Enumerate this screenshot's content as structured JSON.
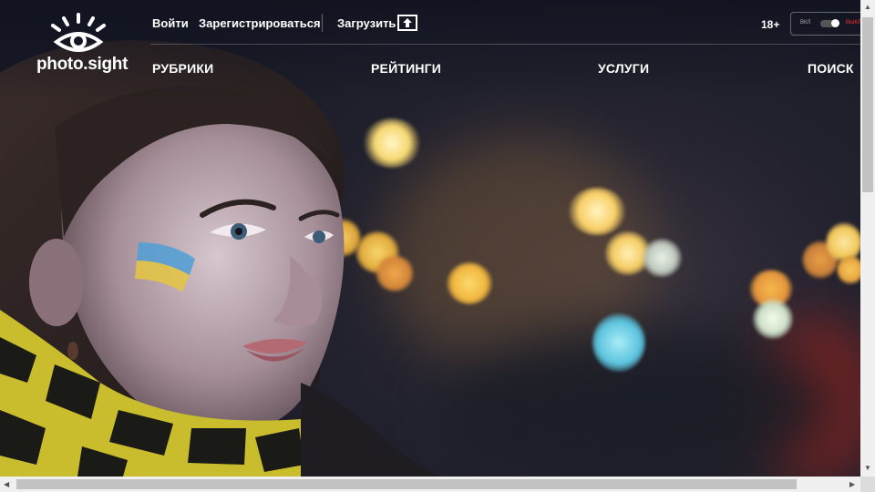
{
  "header": {
    "logo_text": "photo.sight",
    "login_label": "Войти",
    "register_label": "Зарегистрироваться",
    "upload_label": "Загрузить",
    "age_label": "18+",
    "toggle_off_label": "ВКЛ",
    "toggle_on_label": "ВЫКЛ"
  },
  "menu": {
    "rubrics": "РУБРИКИ",
    "ratings": "РЕЙТИНГИ",
    "services": "УСЛУГИ",
    "search": "ПОИСК"
  },
  "colors": {
    "scrollbar_track": "#f0f0f0",
    "scrollbar_thumb": "#c2c2c2",
    "toggle_on_accent": "#e33333"
  },
  "icons": [
    "logo-eye-icon",
    "upload-icon",
    "scroll-up-icon",
    "scroll-down-icon",
    "scroll-left-icon",
    "scroll-right-icon"
  ]
}
